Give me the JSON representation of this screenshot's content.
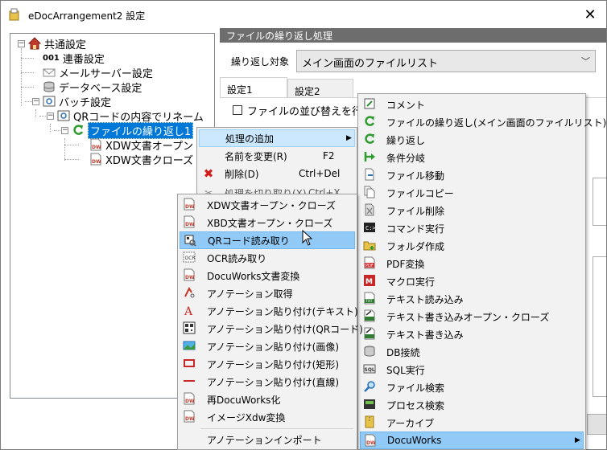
{
  "window": {
    "title": "eDocArrangement2 設定"
  },
  "tree": {
    "items": [
      {
        "label": "共通設定"
      },
      {
        "label": "連番設定",
        "prefix": "001"
      },
      {
        "label": "メールサーバー設定"
      },
      {
        "label": "データベース設定"
      },
      {
        "label": "バッチ設定"
      },
      {
        "label": "QRコードの内容でリネーム"
      },
      {
        "label": "ファイルの繰り返し1"
      },
      {
        "label": "XDW文書オープン"
      },
      {
        "label": "XDW文書クローズ"
      }
    ]
  },
  "panel": {
    "header": "ファイルの繰り返し処理",
    "target_label": "繰り返し対象",
    "target_value": "メイン画面のファイルリスト",
    "tabs": [
      "設定1",
      "設定2"
    ],
    "checkbox_label": "ファイルの並び替えを行"
  },
  "context_menu": {
    "items": [
      {
        "label": "処理の追加",
        "shortcut": ""
      },
      {
        "label": "名前を変更(R)",
        "shortcut": "F2"
      },
      {
        "label": "削除(D)",
        "shortcut": "Ctrl+Del"
      },
      {
        "label": "処理を切り取り(X)",
        "shortcut": "Ctrl+X"
      }
    ]
  },
  "category_menu": {
    "items": [
      {
        "label": "コメント"
      },
      {
        "label": "ファイルの繰り返し(メイン画面のファイルリスト)"
      },
      {
        "label": "繰り返し"
      },
      {
        "label": "条件分岐"
      },
      {
        "label": "ファイル移動"
      },
      {
        "label": "ファイルコピー"
      },
      {
        "label": "ファイル削除"
      },
      {
        "label": "コマンド実行"
      },
      {
        "label": "フォルダ作成"
      },
      {
        "label": "PDF変換"
      },
      {
        "label": "マクロ実行"
      },
      {
        "label": "テキスト読み込み"
      },
      {
        "label": "テキスト書き込みオープン・クローズ"
      },
      {
        "label": "テキスト書き込み"
      },
      {
        "label": "DB接続"
      },
      {
        "label": "SQL実行"
      },
      {
        "label": "ファイル検索"
      },
      {
        "label": "プロセス検索"
      },
      {
        "label": "アーカイブ"
      },
      {
        "label": "DocuWorks"
      }
    ]
  },
  "docuworks_menu": {
    "items": [
      {
        "label": "XDW文書オープン・クローズ"
      },
      {
        "label": "XBD文書オープン・クローズ"
      },
      {
        "label": "QRコード読み取り"
      },
      {
        "label": "OCR読み取り"
      },
      {
        "label": "DocuWorks文書変換"
      },
      {
        "label": "アノテーション取得"
      },
      {
        "label": "アノテーション貼り付け(テキスト)"
      },
      {
        "label": "アノテーション貼り付け(QRコード)"
      },
      {
        "label": "アノテーション貼り付け(画像)"
      },
      {
        "label": "アノテーション貼り付け(矩形)"
      },
      {
        "label": "アノテーション貼り付け(直線)"
      },
      {
        "label": "再DocuWorks化"
      },
      {
        "label": "イメージXdw変換"
      },
      {
        "label": "アノテーションインポート"
      }
    ]
  },
  "colors": {
    "selection": "#0078d7",
    "menu_highlight": "#cce8ff",
    "header_bg": "#6d6d6d"
  }
}
